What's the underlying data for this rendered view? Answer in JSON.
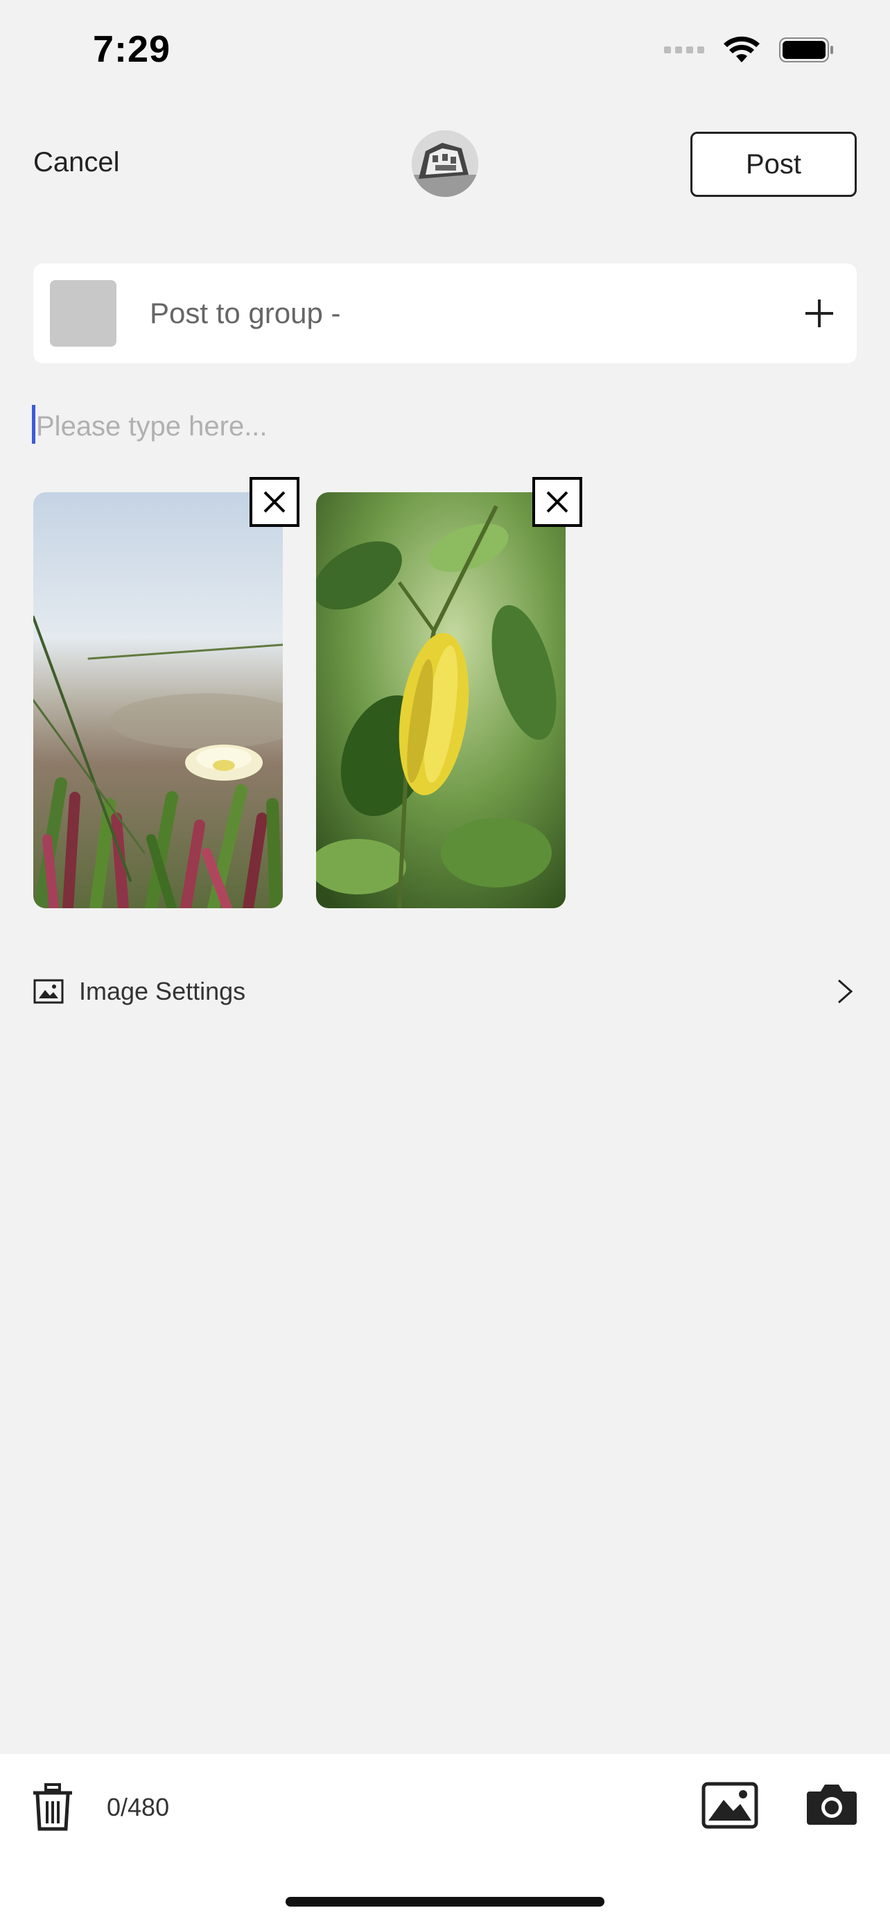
{
  "status_bar": {
    "time": "7:29",
    "icons": [
      "cellular-signal-icon",
      "wifi-icon",
      "battery-icon"
    ]
  },
  "header": {
    "cancel_label": "Cancel",
    "post_label": "Post",
    "avatar_icon": "user-avatar"
  },
  "group": {
    "label": "Post to group -",
    "add_icon": "plus-icon"
  },
  "compose": {
    "value": "",
    "placeholder": "Please type here..."
  },
  "photos": [
    {
      "description_icon": "photo-thumbnail",
      "remove_icon": "close-icon"
    },
    {
      "description_icon": "photo-thumbnail",
      "remove_icon": "close-icon"
    }
  ],
  "image_settings": {
    "label": "Image Settings",
    "icon": "image-icon",
    "chevron": "chevron-right-icon"
  },
  "bottom_bar": {
    "counter": "0/480",
    "icons": [
      "trash-icon",
      "gallery-icon",
      "camera-icon"
    ]
  },
  "colors": {
    "background": "#f2f2f2",
    "card": "#ffffff",
    "caret": "#3d5bd9",
    "text": "#222222",
    "placeholder": "#b0b0b0"
  }
}
